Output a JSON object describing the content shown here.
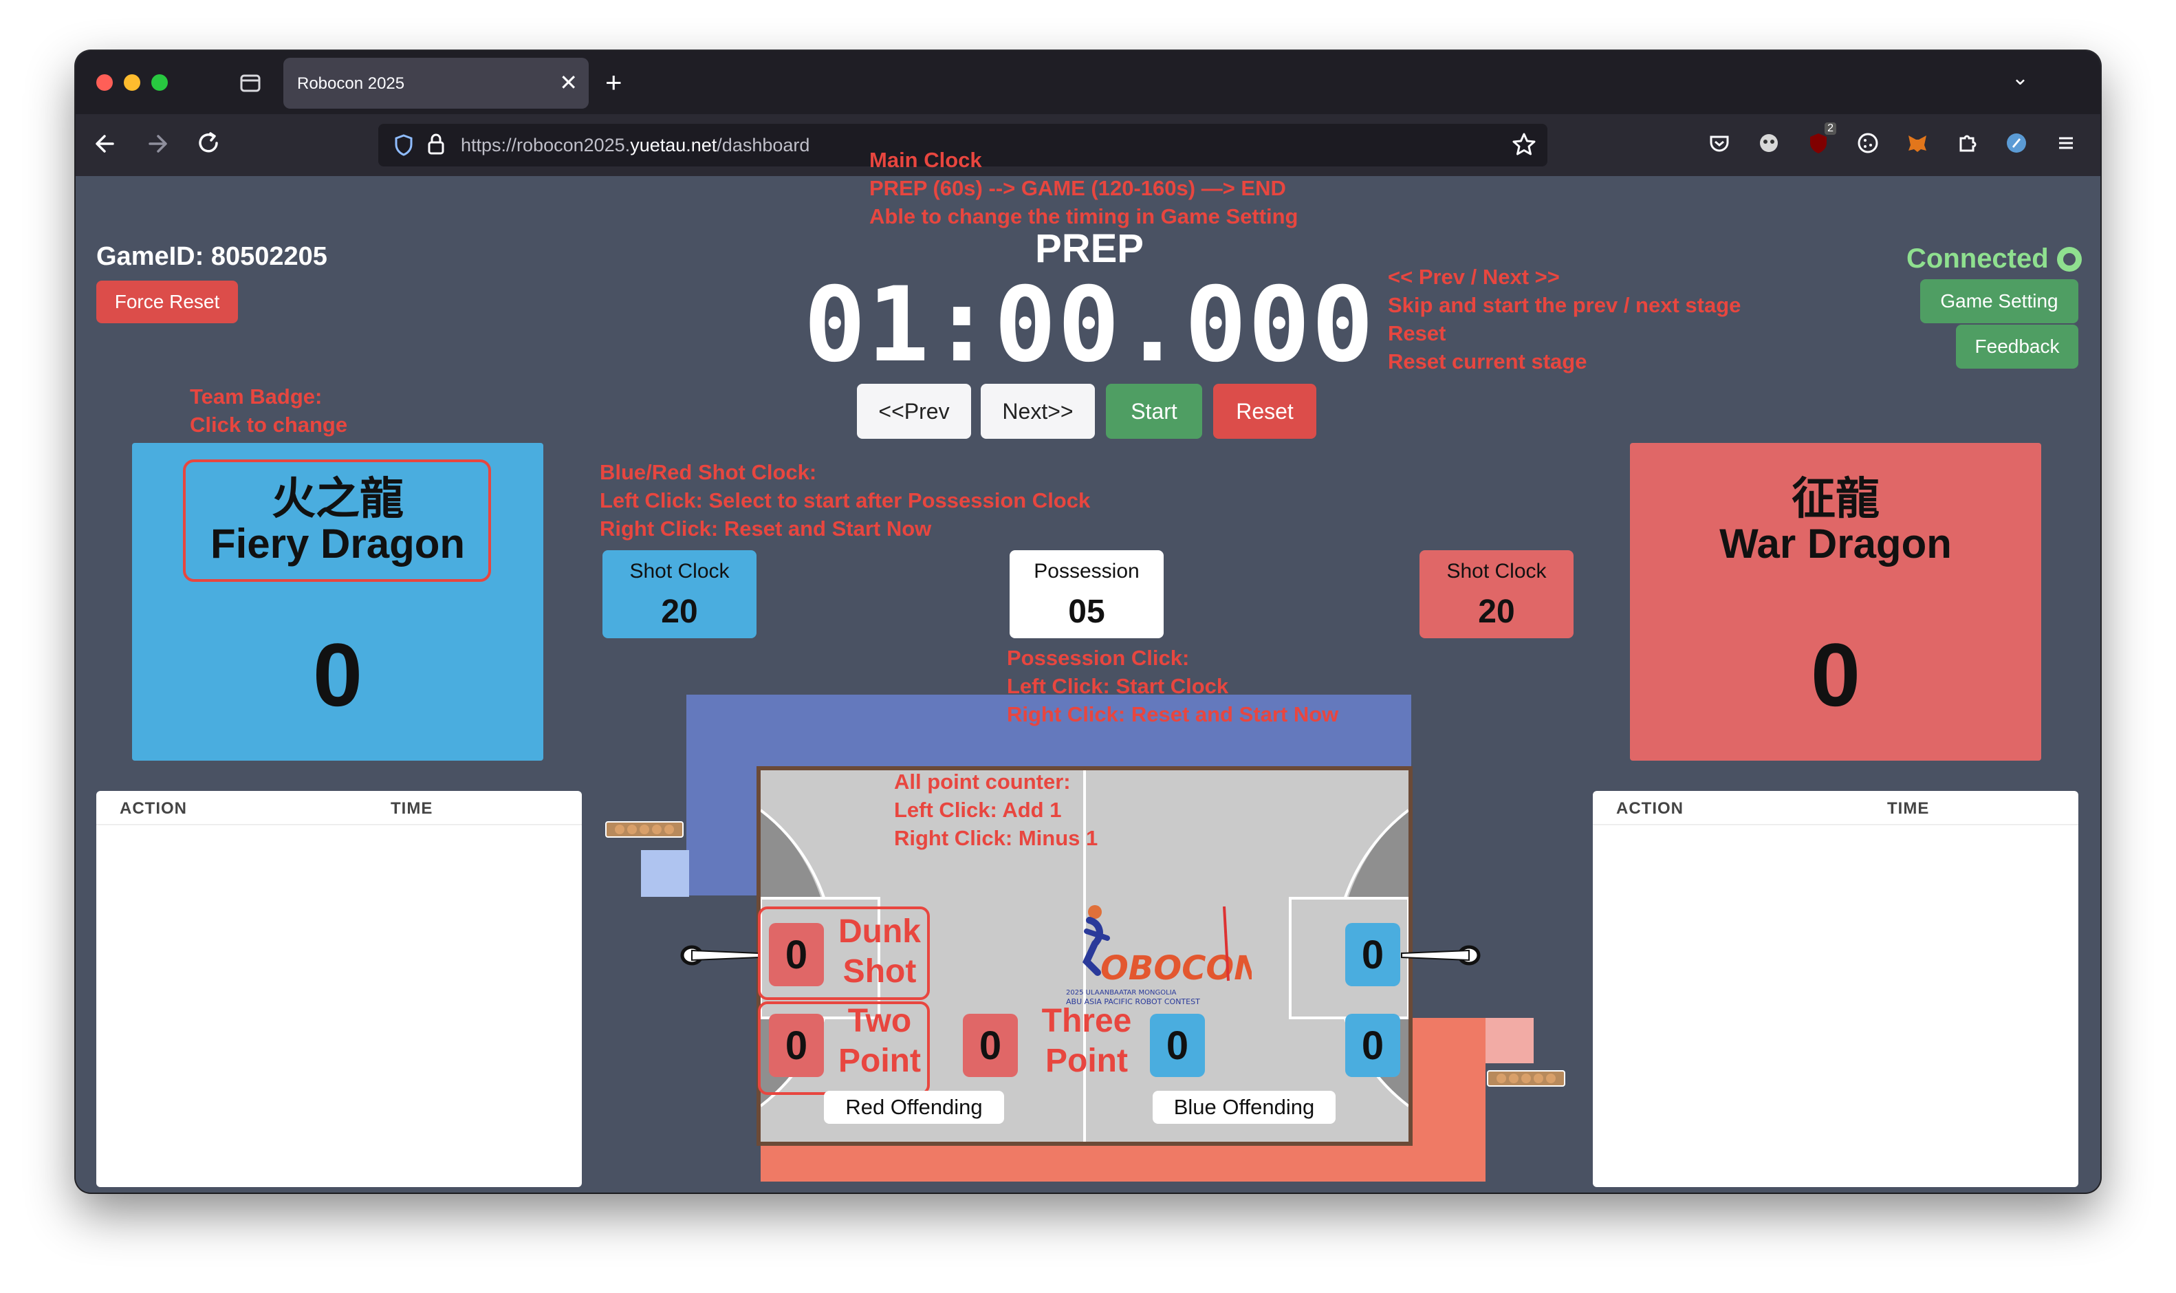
{
  "browser": {
    "tab_title": "Robocon 2025",
    "tab_close": "✕",
    "new_tab": "+",
    "tab_list": "⌄",
    "url_prefix": "https://robocon2025.",
    "url_domain": "yuetau.net",
    "url_path": "/dashboard",
    "ext_badge": "2"
  },
  "header": {
    "game_id": "GameID: 80502205",
    "force_reset": "Force Reset",
    "stage": "PREP",
    "clock": "01:00.000",
    "prev_label": "<<Prev",
    "next_label": "Next>>",
    "start_label": "Start",
    "reset_label": "Reset",
    "connected": "Connected",
    "game_setting": "Game Setting",
    "feedback": "Feedback"
  },
  "annotations": {
    "main_clock": [
      "Main Clock",
      "PREP (60s) --> GAME (120-160s) —> END",
      "Able to change the timing in Game Setting"
    ],
    "prev_next": [
      "<< Prev / Next >>",
      "Skip and start the prev / next stage",
      "Reset",
      "Reset current stage"
    ],
    "team_badge": [
      "Team Badge:",
      "Click to change"
    ],
    "shot_clock": [
      "Blue/Red Shot Clock:",
      "Left Click: Select to start after Possession Clock",
      "Right Click: Reset and Start Now"
    ],
    "possession": [
      "Possession Click:",
      "Left Click: Start Clock",
      "Right Click: Reset and Start Now"
    ],
    "point_counter": [
      "All point counter:",
      "Left Click: Add 1",
      "Right Click: Minus 1"
    ]
  },
  "teams": {
    "blue": {
      "name_cn": "火之龍",
      "name_en": "Fiery Dragon",
      "score": "0",
      "color": "#4aaddf"
    },
    "red": {
      "name_cn": "征龍",
      "name_en": "War Dragon",
      "score": "0",
      "color": "#e06767"
    }
  },
  "clocks": {
    "blue_shot": {
      "label": "Shot Clock",
      "value": "20"
    },
    "possession": {
      "label": "Possession",
      "value": "05"
    },
    "red_shot": {
      "label": "Shot Clock",
      "value": "20"
    }
  },
  "logs": {
    "left": {
      "col_action": "ACTION",
      "col_time": "TIME"
    },
    "right": {
      "col_action": "ACTION",
      "col_time": "TIME"
    }
  },
  "court": {
    "dunk_label": [
      "Dunk",
      "Shot"
    ],
    "two_label": [
      "Two",
      "Point"
    ],
    "three_label": [
      "Three",
      "Point"
    ],
    "red_dunk": "0",
    "red_two": "0",
    "red_three": "0",
    "blue_three": "0",
    "blue_dunk": "0",
    "blue_two": "0",
    "red_offending": "Red Offending",
    "blue_offending": "Blue Offending",
    "logo_text": "OBOCON",
    "logo_sub1": "2025 ULAANBAATAR MONGOLIA",
    "logo_sub2": "ABU ASIA PACIFIC ROBOT CONTEST"
  },
  "icons": {
    "back": "back-arrow-icon",
    "forward": "forward-arrow-icon",
    "reload": "reload-icon",
    "shield": "shield-icon",
    "lock": "lock-icon",
    "star": "bookmark-star-icon"
  }
}
